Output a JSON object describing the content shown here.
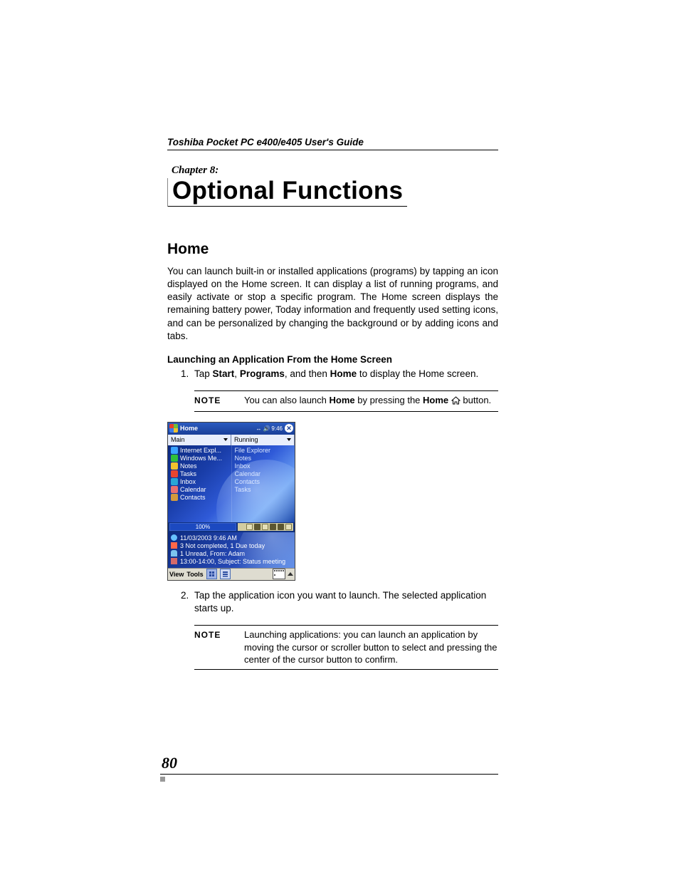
{
  "header": {
    "running": "Toshiba Pocket PC  e400/e405 User's Guide"
  },
  "chapter": {
    "label": "Chapter 8:",
    "title": "Optional Functions"
  },
  "section": {
    "title": "Home",
    "intro": "You can launch built-in or installed applications (programs) by tapping an icon displayed on the Home screen. It can display a list of running programs, and easily activate or stop a specific program. The Home screen displays the remaining battery power, Today information and frequently used setting icons, and can be personalized by changing the background or by adding icons and tabs.",
    "sub1": "Launching an Application From the Home Screen",
    "step1_pre": "Tap ",
    "step1_b1": "Start",
    "step1_mid1": ", ",
    "step1_b2": "Programs",
    "step1_mid2": ", and then ",
    "step1_b3": "Home",
    "step1_post": " to display the Home screen.",
    "step2": "Tap the application icon you want to launch. The selected application starts up."
  },
  "notes": {
    "label": "NOTE",
    "n1_pre": "You can also launch ",
    "n1_b1": "Home",
    "n1_mid": " by pressing the ",
    "n1_b2": "Home",
    "n1_post": " button.",
    "n2": "Launching applications: you can launch an application by moving the cursor or scroller button to select and pressing the center of the cursor button to confirm."
  },
  "device": {
    "app_name": "Home",
    "time": "9:46",
    "tab_left": "Main",
    "tab_right": "Running",
    "left_apps": [
      "Internet Expl...",
      "Windows Me...",
      "Notes",
      "Tasks",
      "Inbox",
      "Calendar",
      "Contacts"
    ],
    "right_running": [
      "File Explorer",
      "Notes",
      "Inbox",
      "Calendar",
      "Contacts",
      "Tasks"
    ],
    "battery": "100%",
    "today": {
      "line1": "11/03/2003 9:46 AM",
      "line2": "3 Not completed, 1 Due today",
      "line3": "1 Unread, From: Adam",
      "line4": "13:00-14:00, Subject: Status meeting"
    },
    "bottom": {
      "view": "View",
      "tools": "Tools"
    }
  },
  "footer": {
    "page": "80"
  }
}
